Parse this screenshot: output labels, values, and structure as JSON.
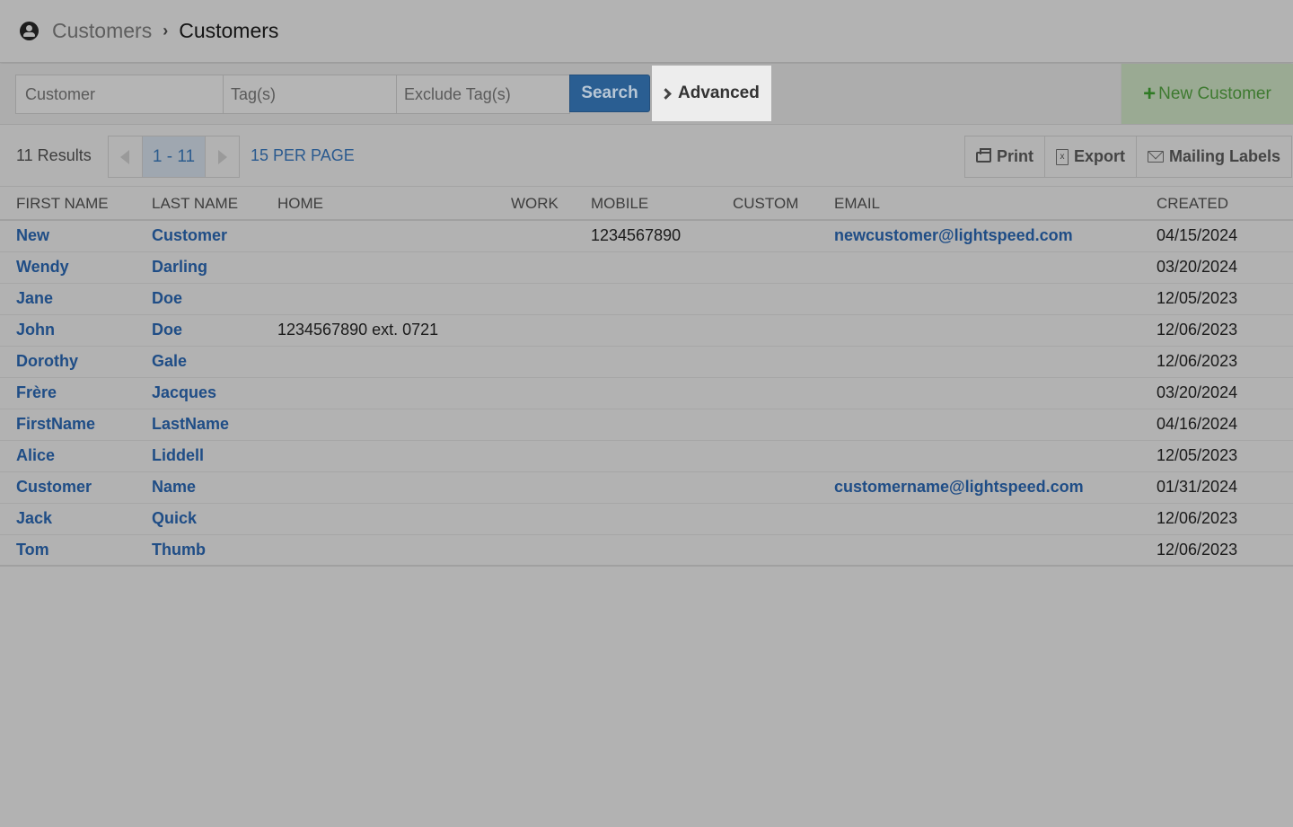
{
  "breadcrumb": {
    "icon": "user-circle-icon",
    "parent": "Customers",
    "separator": "›",
    "current": "Customers"
  },
  "search": {
    "customer_placeholder": "Customer",
    "customer_value": "",
    "tags_placeholder": "Tag(s)",
    "tags_value": "",
    "exclude_tags_placeholder": "Exclude Tag(s)",
    "exclude_tags_value": "",
    "search_label": "Search",
    "advanced_label": "Advanced",
    "new_customer_label": "New Customer"
  },
  "results": {
    "count_label": "11 Results",
    "page_range": "1 - 11",
    "per_page_label": "15 PER PAGE",
    "actions": {
      "print": "Print",
      "export": "Export",
      "mailing_labels": "Mailing Labels"
    }
  },
  "table": {
    "columns": {
      "first_name": "FIRST NAME",
      "last_name": "LAST NAME",
      "home": "HOME",
      "work": "WORK",
      "mobile": "MOBILE",
      "custom": "CUSTOM",
      "email": "EMAIL",
      "created": "CREATED"
    },
    "rows": [
      {
        "first": "New",
        "last": "Customer",
        "home": "",
        "work": "",
        "mobile": "1234567890",
        "custom": "",
        "email": "newcustomer@lightspeed.com",
        "created": "04/15/2024"
      },
      {
        "first": "Wendy",
        "last": "Darling",
        "home": "",
        "work": "",
        "mobile": "",
        "custom": "",
        "email": "",
        "created": "03/20/2024"
      },
      {
        "first": "Jane",
        "last": "Doe",
        "home": "",
        "work": "",
        "mobile": "",
        "custom": "",
        "email": "",
        "created": "12/05/2023"
      },
      {
        "first": "John",
        "last": "Doe",
        "home": "1234567890 ext. 0721",
        "work": "",
        "mobile": "",
        "custom": "",
        "email": "",
        "created": "12/06/2023"
      },
      {
        "first": "Dorothy",
        "last": "Gale",
        "home": "",
        "work": "",
        "mobile": "",
        "custom": "",
        "email": "",
        "created": "12/06/2023"
      },
      {
        "first": "Frère",
        "last": "Jacques",
        "home": "",
        "work": "",
        "mobile": "",
        "custom": "",
        "email": "",
        "created": "03/20/2024"
      },
      {
        "first": "FirstName",
        "last": "LastName",
        "home": "",
        "work": "",
        "mobile": "",
        "custom": "",
        "email": "",
        "created": "04/16/2024"
      },
      {
        "first": "Alice",
        "last": "Liddell",
        "home": "",
        "work": "",
        "mobile": "",
        "custom": "",
        "email": "",
        "created": "12/05/2023"
      },
      {
        "first": "Customer",
        "last": "Name",
        "home": "",
        "work": "",
        "mobile": "",
        "custom": "",
        "email": "customername@lightspeed.com",
        "created": "01/31/2024"
      },
      {
        "first": "Jack",
        "last": "Quick",
        "home": "",
        "work": "",
        "mobile": "",
        "custom": "",
        "email": "",
        "created": "12/06/2023"
      },
      {
        "first": "Tom",
        "last": "Thumb",
        "home": "",
        "work": "",
        "mobile": "",
        "custom": "",
        "email": "",
        "created": "12/06/2023"
      }
    ]
  },
  "colors": {
    "link": "#1f4d86",
    "search_button": "#2a5e92",
    "new_customer_bg": "#9aaa93",
    "new_customer_text": "#3e7a30",
    "highlight_bg": "#ededed",
    "overlay_bg": "#b2b2b2"
  }
}
